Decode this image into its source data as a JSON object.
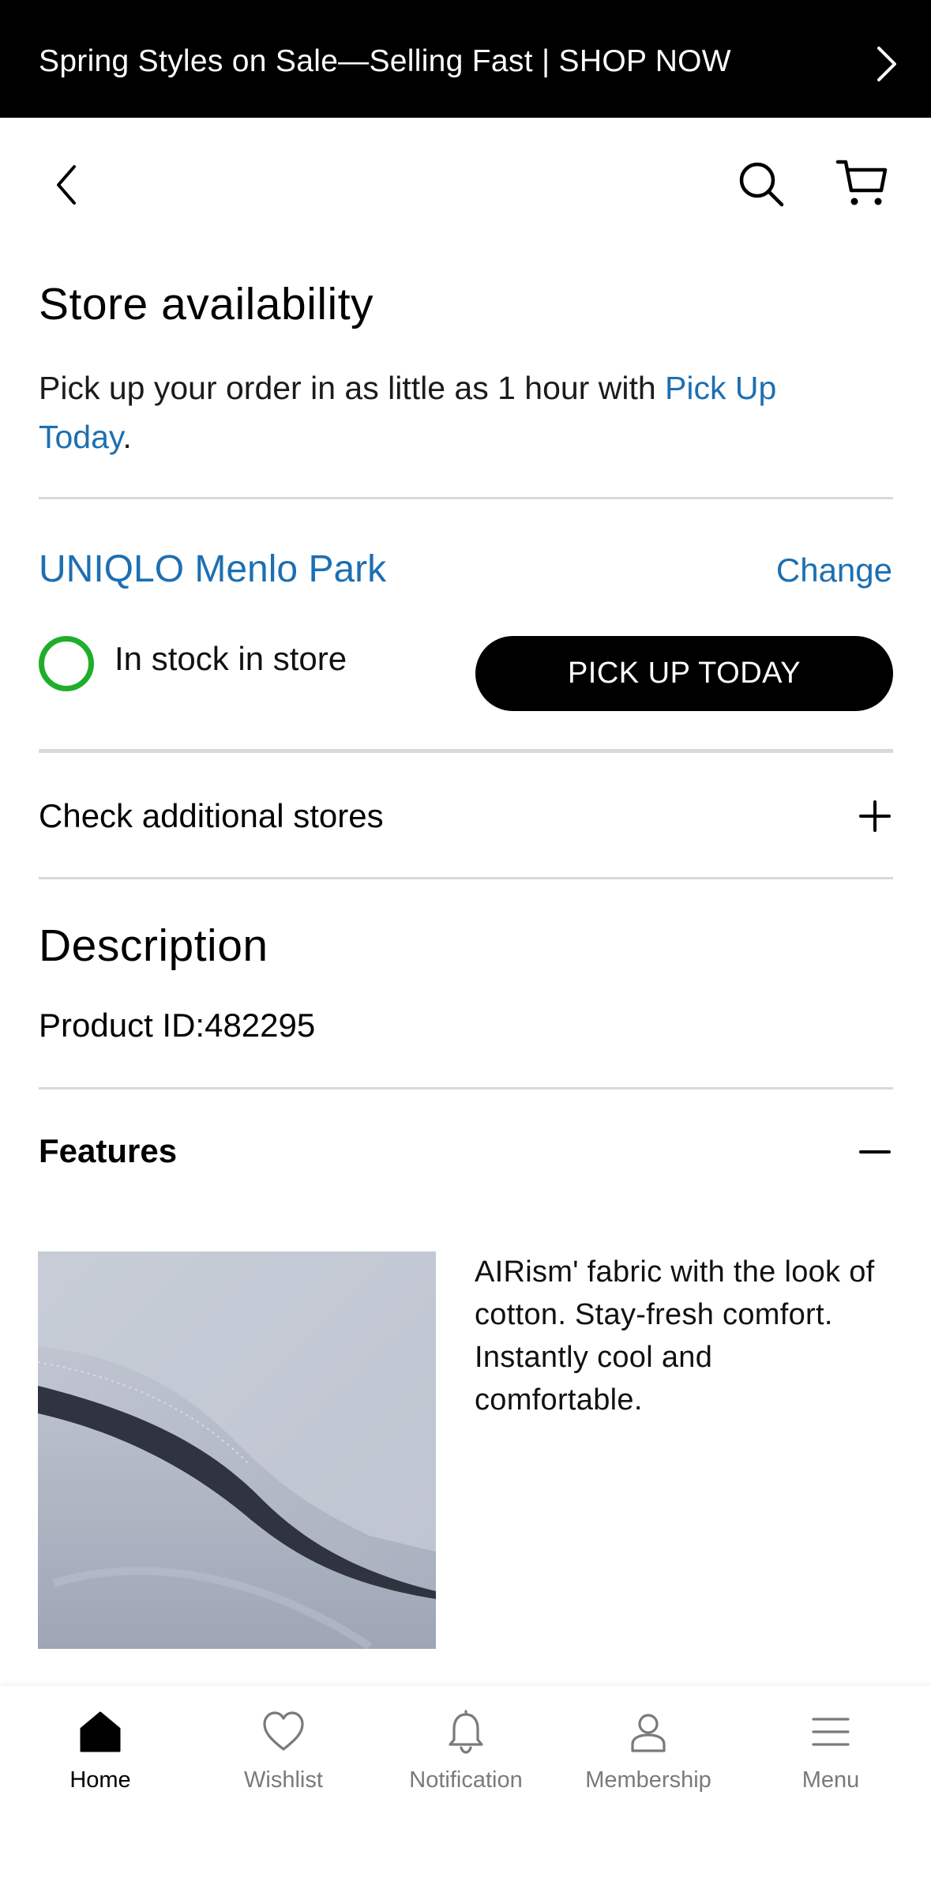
{
  "banner": {
    "text": "Spring Styles on Sale—Selling Fast | SHOP NOW",
    "chevron_icon": "chevron-right-icon"
  },
  "header": {
    "back_icon": "chevron-left-icon",
    "search_icon": "search-icon",
    "cart_icon": "cart-icon"
  },
  "store_availability": {
    "title": "Store availability",
    "intro_prefix": "Pick up your order in as little as 1 hour with ",
    "intro_link": "Pick Up Today",
    "intro_suffix": ".",
    "store_name": "UNIQLO Menlo Park",
    "change_label": "Change",
    "stock_status": "In stock in store",
    "pickup_button": "PICK UP TODAY",
    "additional_stores": "Check additional stores"
  },
  "description": {
    "title": "Description",
    "product_id": "Product ID:482295"
  },
  "features": {
    "title": "Features",
    "text": "AIRism' fabric with the look of cotton. Stay-fresh comfort. Instantly cool and comfortable."
  },
  "bottom_nav": {
    "items": [
      {
        "label": "Home",
        "icon": "home-icon",
        "active": true
      },
      {
        "label": "Wishlist",
        "icon": "heart-icon",
        "active": false
      },
      {
        "label": "Notification",
        "icon": "bell-icon",
        "active": false
      },
      {
        "label": "Membership",
        "icon": "person-icon",
        "active": false
      },
      {
        "label": "Menu",
        "icon": "menu-icon",
        "active": false
      }
    ]
  },
  "colors": {
    "link": "#1d6fb2",
    "in_stock": "#1fae2a",
    "banner_bg": "#000000",
    "nav_inactive": "#7a7a7a"
  }
}
